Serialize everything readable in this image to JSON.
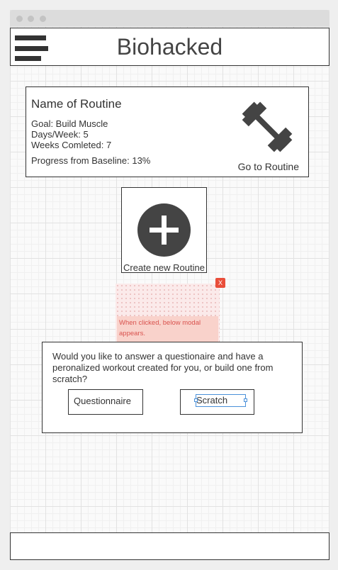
{
  "header": {
    "title": "Biohacked",
    "menu_icon": "hamburger-menu-icon"
  },
  "routine_card": {
    "name": "Name of Routine",
    "goal": "Goal: Build Muscle",
    "days_per_week": "Days/Week: 5",
    "weeks_completed": "Weeks Comleted: 7",
    "progress": "Progress from Baseline: 13%",
    "icon": "dumbbell-icon",
    "link_label": "Go to Routine"
  },
  "create_routine": {
    "icon": "plus-circle-icon",
    "label": "Create new Routine"
  },
  "note": {
    "close_label": "X",
    "text": "When clicked, below modal appears."
  },
  "modal": {
    "question": "Would you like to answer a questionaire and have a peronalized workout created for you, or build one from scratch?",
    "questionnaire_label": "Questionnaire",
    "scratch_label": "Scratch"
  },
  "colors": {
    "icon_dark": "#444444",
    "border": "#333333",
    "note_accent": "#e94e3a",
    "selection_blue": "#4a90d9"
  }
}
